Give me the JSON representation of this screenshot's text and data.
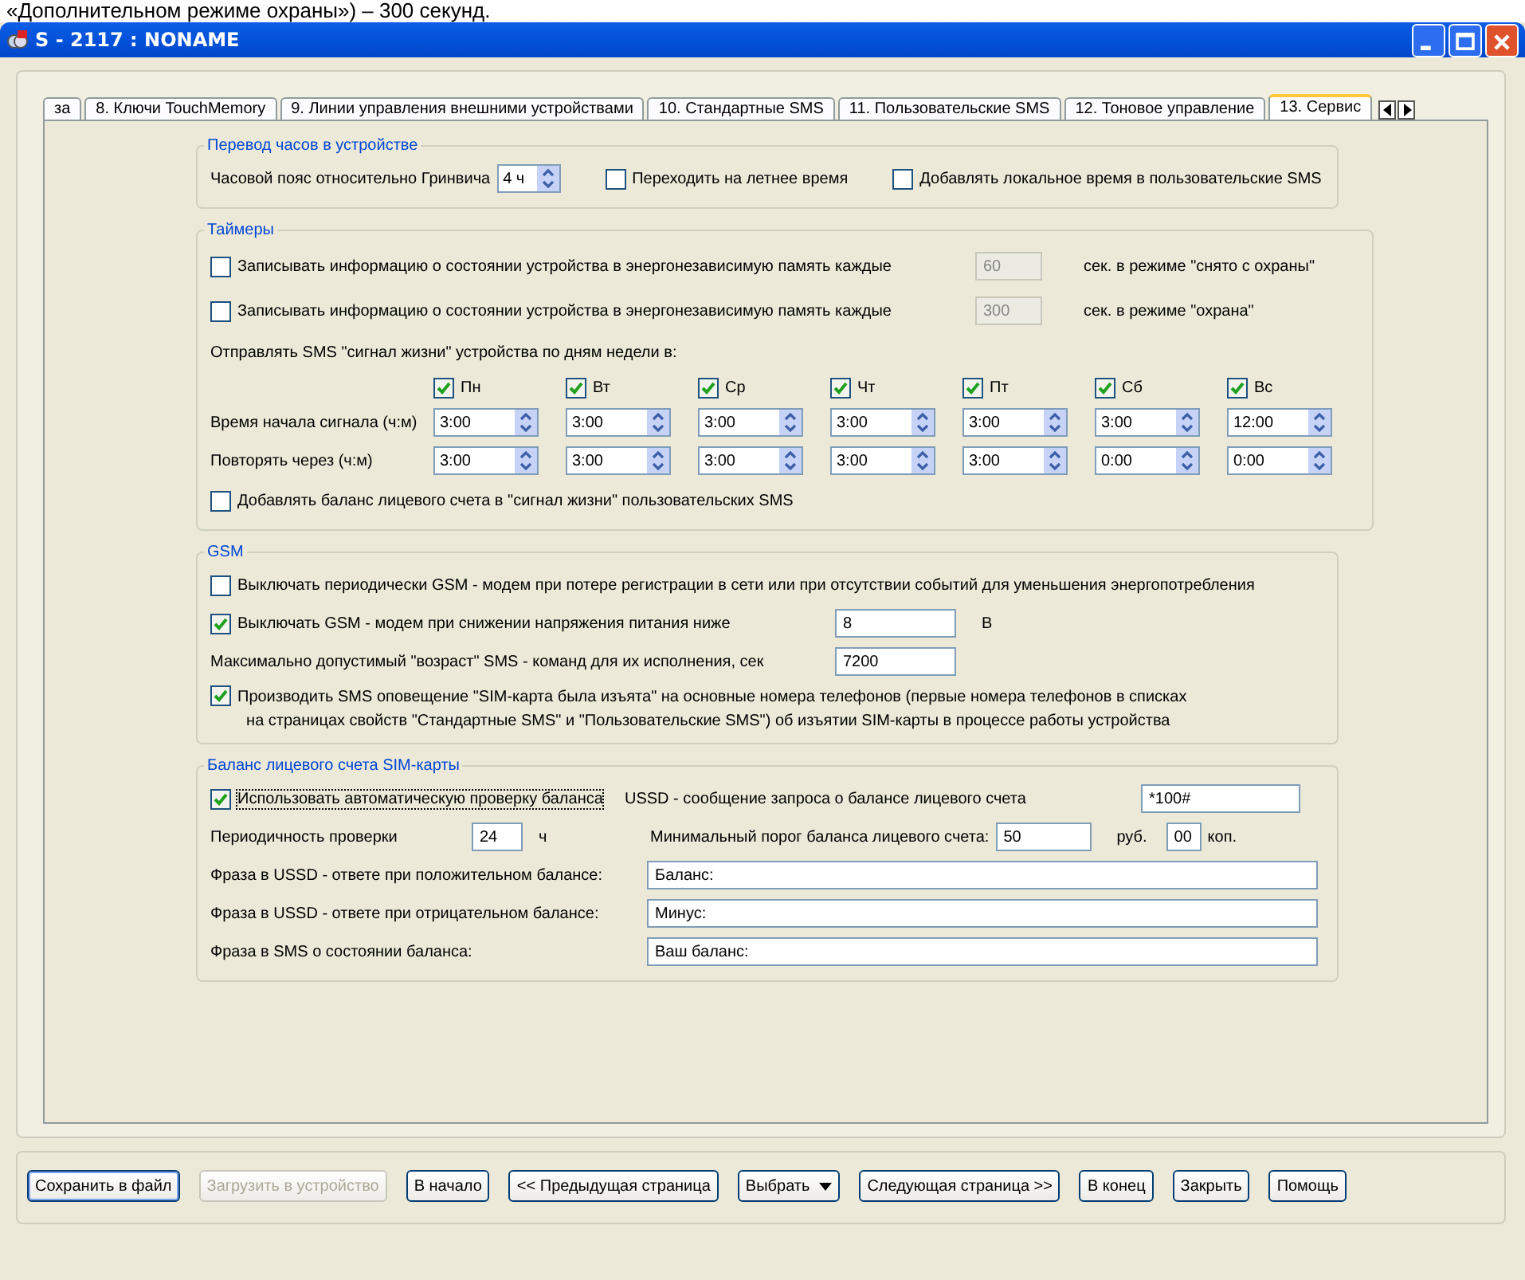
{
  "top_caption": "«Дополнительном режиме охраны») – 300 секунд.",
  "window": {
    "title": "S - 2117 : NONAME"
  },
  "tabs": [
    {
      "label": "за",
      "selected": false
    },
    {
      "label": "8. Ключи TouchMemory",
      "selected": false
    },
    {
      "label": "9. Линии управления внешними устройствами",
      "selected": false
    },
    {
      "label": "10. Стандартные SMS",
      "selected": false
    },
    {
      "label": "11. Пользовательские SMS",
      "selected": false
    },
    {
      "label": "12. Тоновое управление",
      "selected": false
    },
    {
      "label": "13. Сервис",
      "selected": true
    }
  ],
  "clock": {
    "title": "Перевод часов в устройстве",
    "timezone_label": "Часовой пояс относительно Гринвича",
    "timezone_value": "4 ч",
    "options": [
      {
        "label": "Переходить на летнее время",
        "checked": false
      },
      {
        "label": "Добавлять локальное время в пользовательские SMS",
        "checked": false
      }
    ]
  },
  "timers": {
    "title": "Таймеры",
    "log_rows": [
      {
        "label": "Записывать информацию о состоянии устройства в энергонезависимую память каждые",
        "checked": false,
        "value": "60",
        "disabled": true,
        "suffix": "сек. в режиме \"снято с охраны\""
      },
      {
        "label": "Записывать информацию о состоянии устройства в энергонезависимую память каждые",
        "checked": false,
        "value": "300",
        "disabled": true,
        "suffix": "сек. в режиме \"охрана\""
      }
    ],
    "heartbeat_label": "Отправлять SMS \"сигнал жизни\" устройства по дням недели в:",
    "start_label": "Время начала сигнала (ч:м)",
    "repeat_label": "Повторять через (ч:м)",
    "days": [
      {
        "label": "Пн",
        "checked": true,
        "start": "3:00",
        "repeat": "3:00"
      },
      {
        "label": "Вт",
        "checked": true,
        "start": "3:00",
        "repeat": "3:00"
      },
      {
        "label": "Ср",
        "checked": true,
        "start": "3:00",
        "repeat": "3:00"
      },
      {
        "label": "Чт",
        "checked": true,
        "start": "3:00",
        "repeat": "3:00"
      },
      {
        "label": "Пт",
        "checked": true,
        "start": "3:00",
        "repeat": "3:00"
      },
      {
        "label": "Сб",
        "checked": true,
        "start": "3:00",
        "repeat": "0:00"
      },
      {
        "label": "Вс",
        "checked": true,
        "start": "12:00",
        "repeat": "0:00"
      }
    ],
    "balance_option": {
      "label": "Добавлять баланс лицевого счета в \"сигнал жизни\" пользовательских SMS",
      "checked": false
    }
  },
  "gsm": {
    "title": "GSM",
    "periodic": {
      "label": "Выключать периодически GSM - модем при потере регистрации в сети или при отсутствии событий для уменьшения энергопотребления",
      "checked": false
    },
    "low_voltage": {
      "label": "Выключать GSM - модем при снижении напряжения питания ниже",
      "checked": true,
      "value": "8",
      "unit": "В"
    },
    "max_age": {
      "label": "Максимально допустимый \"возраст\" SMS - команд для их исполнения, сек",
      "value": "7200"
    },
    "sim_notice": {
      "label": "Производить SMS оповещение \"SIM-карта была изъята\" на основные номера телефонов (первые номера телефонов в списках",
      "label_line_2": "на страницах свойств \"Стандартные SMS\" и \"Пользовательские SMS\") об изъятии SIM-карты в процессе работы устройства",
      "checked": true
    }
  },
  "balance": {
    "title": "Баланс лицевого счета SIM-карты",
    "auto_check": {
      "label": "Использовать автоматическую проверку баланса",
      "checked": true
    },
    "ussd_label": "USSD - сообщение запроса о балансе лицевого счета",
    "ussd_value": "*100#",
    "period_label": "Периодичность проверки",
    "period_value": "24",
    "period_unit": "ч",
    "threshold_label": "Минимальный порог баланса лицевого счета:",
    "rub_value": "50",
    "rub_unit": "руб.",
    "kop_value": "00",
    "kop_unit": "коп.",
    "phrases": [
      {
        "label": "Фраза в USSD - ответе при положительном балансе:",
        "value": "Баланс:"
      },
      {
        "label": "Фраза в USSD - ответе при отрицательном балансе:",
        "value": "Минус:"
      },
      {
        "label": "Фраза в SMS о состоянии баланса:",
        "value": "Ваш баланс:"
      }
    ]
  },
  "buttons": [
    {
      "label": "Сохранить в файл",
      "kind": "plain",
      "disabled": false,
      "focused": true
    },
    {
      "label": "Загрузить в устройство",
      "kind": "plain",
      "disabled": true,
      "focused": false
    },
    {
      "label": "В начало",
      "kind": "plain",
      "disabled": false,
      "focused": false
    },
    {
      "label": "<< Предыдущая страница",
      "kind": "plain",
      "disabled": false,
      "focused": false
    },
    {
      "label": "Выбрать",
      "kind": "dropdown",
      "disabled": false,
      "focused": false
    },
    {
      "label": "Следующая страница >>",
      "kind": "plain",
      "disabled": false,
      "focused": false
    },
    {
      "label": "В конец",
      "kind": "plain",
      "disabled": false,
      "focused": false
    },
    {
      "label": "Закрыть",
      "kind": "plain",
      "disabled": false,
      "focused": false
    },
    {
      "label": "Помощь",
      "kind": "plain",
      "disabled": false,
      "focused": false
    }
  ]
}
